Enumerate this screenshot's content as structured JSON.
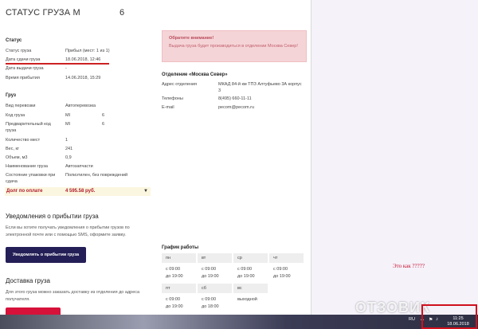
{
  "title": {
    "text": "СТАТУС ГРУЗА М",
    "number": "6"
  },
  "status": {
    "heading": "Статус",
    "rows": [
      {
        "label": "Статус груза",
        "value": "Прибыл (мест: 1 из 1)"
      },
      {
        "label": "Дата сдачи груза",
        "value": "18.06.2018, 12:46"
      },
      {
        "label": "Дата выдачи груза",
        "value": "-"
      },
      {
        "label": "Время прибытия",
        "value": "14.06.2018, 15:29"
      }
    ]
  },
  "cargo": {
    "heading": "Груз",
    "rows": [
      {
        "label": "Вид перевозки",
        "value": "Автоперевозка",
        "value2": ""
      },
      {
        "label": "Код груза",
        "value": "МI",
        "value2": "6"
      },
      {
        "label": "Предварительный код груза",
        "value": "МI",
        "value2": "6"
      },
      {
        "label": "Количество мест",
        "value": "1",
        "value2": ""
      },
      {
        "label": "Вес, кг",
        "value": "241",
        "value2": ""
      },
      {
        "label": "Объем, м3",
        "value": "0,9",
        "value2": ""
      },
      {
        "label": "Наименование груза",
        "value": "Автозапчасти",
        "value2": ""
      },
      {
        "label": "Состояние упаковки при сдача",
        "value": "Полиэтилен, без повреждений",
        "value2": ""
      }
    ],
    "debt_label": "Долг по оплате",
    "debt_value": "4 595.58 руб."
  },
  "alert": {
    "heading": "Обратите внимание!",
    "text": "Выдача груза будет производиться в отделении Москва Север!"
  },
  "branch": {
    "heading": "Отделение «Москва Север»",
    "rows": [
      {
        "label": "Адрес отделения",
        "value": "МКАД 84-й км ТПЗ Алтуфьево 3А корпус 3"
      },
      {
        "label": "Телефоны",
        "value": "8(495) 660-11-11"
      },
      {
        "label": "E-mail",
        "value": "pecom@pecom.ru"
      }
    ]
  },
  "notifications": {
    "heading": "Уведомления о прибытии груза",
    "text": "Если вы хотите получать уведомления о прибытии грузов по электронной почте или с помощью SMS, оформите заявку.",
    "button": "Уведомлять о прибытии груза"
  },
  "delivery": {
    "heading": "Доставка груза",
    "text": "Для этого груза можно заказать доставку из отделения до адреса получателя."
  },
  "schedule": {
    "heading": "График работы",
    "days": [
      {
        "name": "пн",
        "l1": "с 09:00",
        "l2": "до 19:00"
      },
      {
        "name": "вт",
        "l1": "с 09:00",
        "l2": "до 19:00"
      },
      {
        "name": "ср",
        "l1": "с 09:00",
        "l2": "до 19:00"
      },
      {
        "name": "чт",
        "l1": "с 09:00",
        "l2": "до 19:00"
      },
      {
        "name": "пт",
        "l1": "с 09:00",
        "l2": "до 19:00"
      },
      {
        "name": "сб",
        "l1": "с 09:00",
        "l2": "до 18:00"
      },
      {
        "name": "вс",
        "l1": "выходной",
        "l2": ""
      }
    ]
  },
  "annotation": "Это как ?????",
  "watermark": "ОТЗОВИК",
  "taskbar": {
    "lang": "RU",
    "time": "11:25",
    "date": "18.06.2018"
  },
  "colors": {
    "accent_button": "#241f56",
    "debt_text": "#b01a2a",
    "alert_bg": "#f5d4d7",
    "highlight": "#cc2222"
  }
}
